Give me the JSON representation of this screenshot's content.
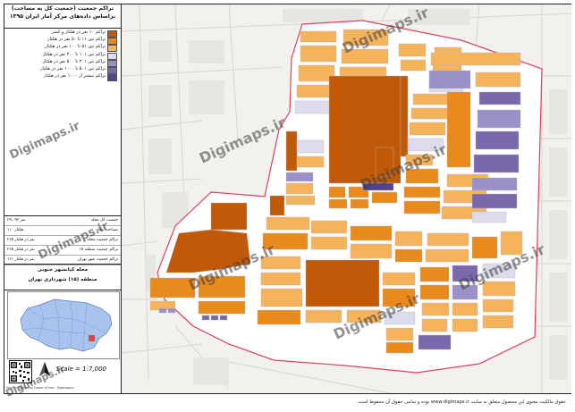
{
  "title": {
    "line1": "تراکم جمعیت (جمعیت کل به مساحت)",
    "line2": "براساس داده‌های مرکز آمار ایران ۱۳۹۵"
  },
  "legend": [
    {
      "label": "تراکم ۱۰ نفر در هکتار و کمتر",
      "color": "#c05a08"
    },
    {
      "label": "تراکم بین ۱۱ تا ۵۰ نفر در هکتار",
      "color": "#e88a1c"
    },
    {
      "label": "تراکم بین ۵۱ تا ۱۰۰ نفر در هکتار",
      "color": "#f5b35c"
    },
    {
      "label": "تراکم بین ۱۰۱ تا ۲۰۰ نفر در هکتار",
      "color": "#dcdcec"
    },
    {
      "label": "تراکم بین ۲۰۱ تا ۵۰۰ نفر در هکتار",
      "color": "#9b8fc8"
    },
    {
      "label": "تراکم بین ۵۰۱ تا ۱۰۰۰ نفر در هکتار",
      "color": "#7a68ad"
    },
    {
      "label": "تراکم بیشتر از ۱۰۰۰ نفر در هکتار",
      "color": "#55418f"
    }
  ],
  "stats": [
    {
      "label": "جمعیت کل محله",
      "value": "۲۹،۰۹۳ نفر"
    },
    {
      "label": "مساحت محله",
      "value": "۱۱۰ هکتار"
    },
    {
      "label": "تراکم جمعیت محله",
      "value": "۲۶۵ نفر در هکتار"
    },
    {
      "label": "تراکم جمعیت منطقه ۱۵",
      "value": "۲۶۵ نفر در هکتار"
    },
    {
      "label": "تراکم جمعیت شهر تهران",
      "value": "۱۶۱ نفر در هکتار"
    }
  ],
  "district": {
    "line1": "محله کیانشهر جنوبی",
    "line2": "منطقه (۱۵) شهرداری تهران"
  },
  "scale_text": "Scale = 1:7,000",
  "north_label": "N",
  "credit": "Source: Statistical Center of Iran - Digimaps.ir",
  "watermark": "Digimaps.ir",
  "footer": "حقوق مالکیت معنوی این محصول متعلق به سایت www.digimaps.ir بوده و تمامی حقوق آن محفوظ است.",
  "colors": {
    "c1": "#c05a08",
    "c2": "#e88a1c",
    "c3": "#f5b35c",
    "c4": "#dcdcec",
    "c5": "#9b8fc8",
    "c6": "#7a68ad",
    "c7": "#55418f",
    "boundary": "#e0405a",
    "road": "#ffffff"
  }
}
